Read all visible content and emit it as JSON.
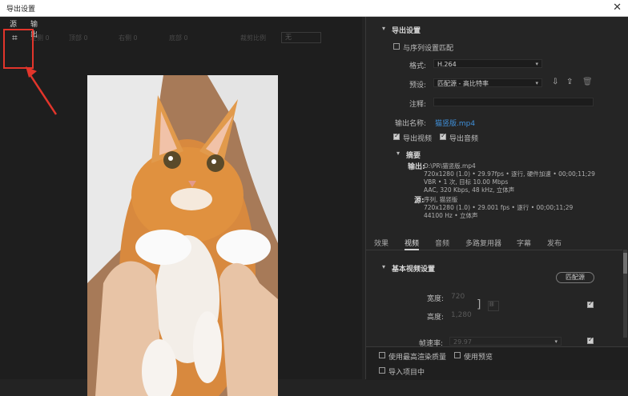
{
  "window": {
    "title": "导出设置",
    "close": "✕"
  },
  "left_tabs": {
    "source": "源",
    "output": "输出"
  },
  "toolbar": {
    "items": [
      "左侧 0",
      "顶部 0",
      "右侧 0",
      "底部 0",
      "裁剪比例"
    ],
    "crop_ratio_value": "无"
  },
  "export_settings": {
    "section_title": "导出设置",
    "match_sequence_label": "与序列设置匹配",
    "format_label": "格式:",
    "format_value": "H.264",
    "preset_label": "预设:",
    "preset_value": "匹配源 - 高比特率",
    "comment_label": "注释:",
    "comment_value": "",
    "output_name_label": "输出名称:",
    "output_name_value": "猫竖版.mp4",
    "export_video_label": "导出视频",
    "export_audio_label": "导出音频"
  },
  "summary": {
    "title": "摘要",
    "output_label": "输出:",
    "output_lines": [
      "D:\\PR\\猫竖版.mp4",
      "720x1280 (1.0) • 29.97fps • 逐行, 硬件加速 • 00;00;11;29",
      "VBR • 1 次, 目标 10.00 Mbps",
      "AAC, 320 Kbps, 48 kHz, 立体声"
    ],
    "source_label": "源:",
    "source_lines": [
      "序列, 猫竖版",
      "720x1280 (1.0) • 29.001 fps • 逐行 • 00;00;11;29",
      "44100 Hz • 立体声"
    ]
  },
  "tabs": [
    "效果",
    "视频",
    "音频",
    "多路复用器",
    "字幕",
    "发布"
  ],
  "active_tab": "视频",
  "basic_video": {
    "title": "基本视频设置",
    "match_source_button": "匹配源",
    "width_label": "宽度:",
    "width_value": "720",
    "height_label": "高度:",
    "height_value": "1,280",
    "frame_rate_label": "帧速率:",
    "frame_rate_value": "29.97"
  },
  "bottom": {
    "max_render_quality": "使用最高渲染质量",
    "use_previews": "使用预览",
    "import_into_project": "导入项目中"
  },
  "colors": {
    "annotation_red": "#e2352b",
    "link_blue": "#3f8fd8",
    "panel_bg": "#252525"
  }
}
